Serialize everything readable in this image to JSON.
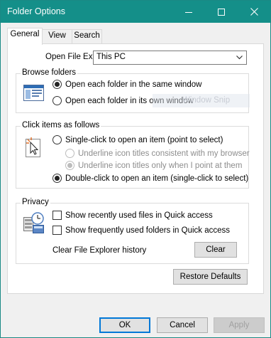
{
  "window": {
    "title": "Folder Options",
    "title_color": "#148f89",
    "controls": {
      "minimize": "minimize-icon",
      "maximize": "maximize-icon",
      "close": "close-icon"
    }
  },
  "tabs": [
    {
      "label": "General",
      "active": true
    },
    {
      "label": "View",
      "active": false
    },
    {
      "label": "Search",
      "active": false
    }
  ],
  "general": {
    "open_label": "Open File Explorer to:",
    "open_value": "This PC",
    "browse": {
      "title": "Browse folders",
      "options": [
        {
          "label": "Open each folder in the same window",
          "checked": true
        },
        {
          "label": "Open each folder in its own window",
          "checked": false
        }
      ]
    },
    "click": {
      "title": "Click items as follows",
      "single": {
        "label": "Single-click to open an item (point to select)",
        "checked": false
      },
      "underline_consistent": {
        "label": "Underline icon titles consistent with my browser",
        "checked": false,
        "disabled": true
      },
      "underline_point": {
        "label": "Underline icon titles only when I point at them",
        "checked": true,
        "disabled": true
      },
      "double": {
        "label": "Double-click to open an item (single-click to select)",
        "checked": true
      }
    },
    "privacy": {
      "title": "Privacy",
      "recent_files": {
        "label": "Show recently used files in Quick access",
        "checked": false
      },
      "frequent_folders": {
        "label": "Show frequently used folders in Quick access",
        "checked": false
      },
      "clear_history_label": "Clear File Explorer history",
      "clear_button": "Clear"
    },
    "restore_defaults": "Restore Defaults"
  },
  "overlay_text": "Window Snip",
  "footer": {
    "ok": "OK",
    "cancel": "Cancel",
    "apply": "Apply"
  }
}
